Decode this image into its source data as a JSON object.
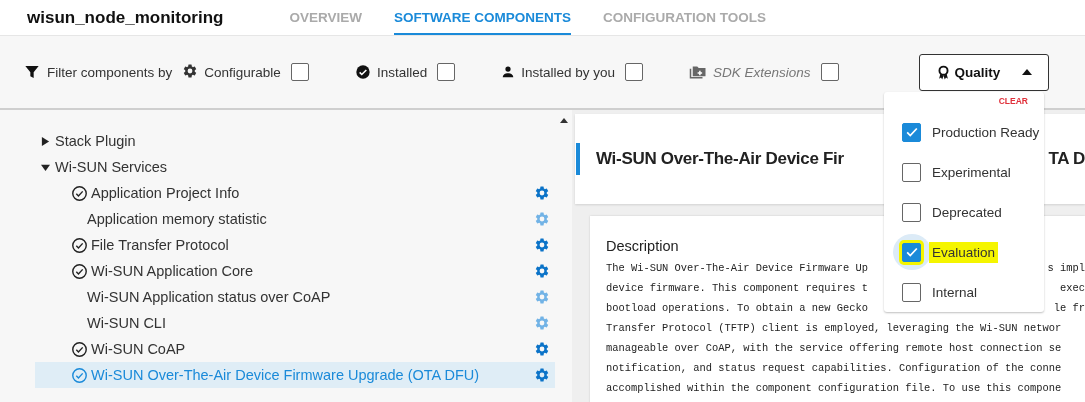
{
  "app": {
    "title": "wisun_node_monitoring"
  },
  "tabs": [
    {
      "label": "OVERVIEW",
      "selected": false
    },
    {
      "label": "SOFTWARE COMPONENTS",
      "selected": true
    },
    {
      "label": "CONFIGURATION TOOLS",
      "selected": false
    }
  ],
  "filters": {
    "label": "Filter components by",
    "options": [
      {
        "kind": "configurable",
        "label": "Configurable",
        "checked": false
      },
      {
        "kind": "installed",
        "label": "Installed",
        "checked": false
      },
      {
        "kind": "user",
        "label": "Installed by you",
        "checked": false
      },
      {
        "kind": "sdk",
        "label": "SDK Extensions",
        "checked": false
      }
    ]
  },
  "quality": {
    "label": "Quality",
    "expanded": true,
    "clear": "CLEAR",
    "options": [
      {
        "label": "Production Ready",
        "checked": true,
        "highlighted": false
      },
      {
        "label": "Experimental",
        "checked": false,
        "highlighted": false
      },
      {
        "label": "Deprecated",
        "checked": false,
        "highlighted": false
      },
      {
        "label": "Evaluation",
        "checked": true,
        "highlighted": true
      },
      {
        "label": "Internal",
        "checked": false,
        "highlighted": false
      }
    ]
  },
  "tree": [
    {
      "label": "Stack Plugin",
      "expanded": false
    },
    {
      "label": "Wi-SUN Services",
      "expanded": true,
      "children": [
        {
          "label": "Application Project Info",
          "installed": true,
          "selected": false
        },
        {
          "label": "Application memory statistic",
          "installed": false,
          "selected": false
        },
        {
          "label": "File Transfer Protocol",
          "installed": true,
          "selected": false
        },
        {
          "label": "Wi-SUN Application Core",
          "installed": true,
          "selected": false
        },
        {
          "label": "Wi-SUN Application status over CoAP",
          "installed": false,
          "selected": false
        },
        {
          "label": "Wi-SUN CLI",
          "installed": false,
          "selected": false
        },
        {
          "label": "Wi-SUN CoAP",
          "installed": true,
          "selected": false
        },
        {
          "label": "Wi-SUN Over-The-Air Device Firmware Upgrade (OTA DFU)",
          "installed": true,
          "selected": true
        }
      ]
    }
  ],
  "detail": {
    "title": {
      "left": "Wi-SUN Over-The-Air Device Fir",
      "right": "TA D"
    },
    "section": "Description",
    "lines": [
      {
        "left": "The Wi-SUN Over-The-Air Device Firmware Up",
        "right": "s impl"
      },
      {
        "left": "device firmware. This component requires t",
        "right": "exec"
      },
      {
        "left": "bootload operations. To obtain a new Gecko",
        "right": "le fr"
      },
      {
        "left": "Transfer Protocol (TFTP) client is employed, leveraging the Wi-SUN networ"
      },
      {
        "left": "manageable over CoAP, with the service offering remote host connection se"
      },
      {
        "left": "notification, and status request capabilities. Configuration of the conne"
      },
      {
        "left": "accomplished within the component configuration file. To use this compone"
      }
    ]
  }
}
